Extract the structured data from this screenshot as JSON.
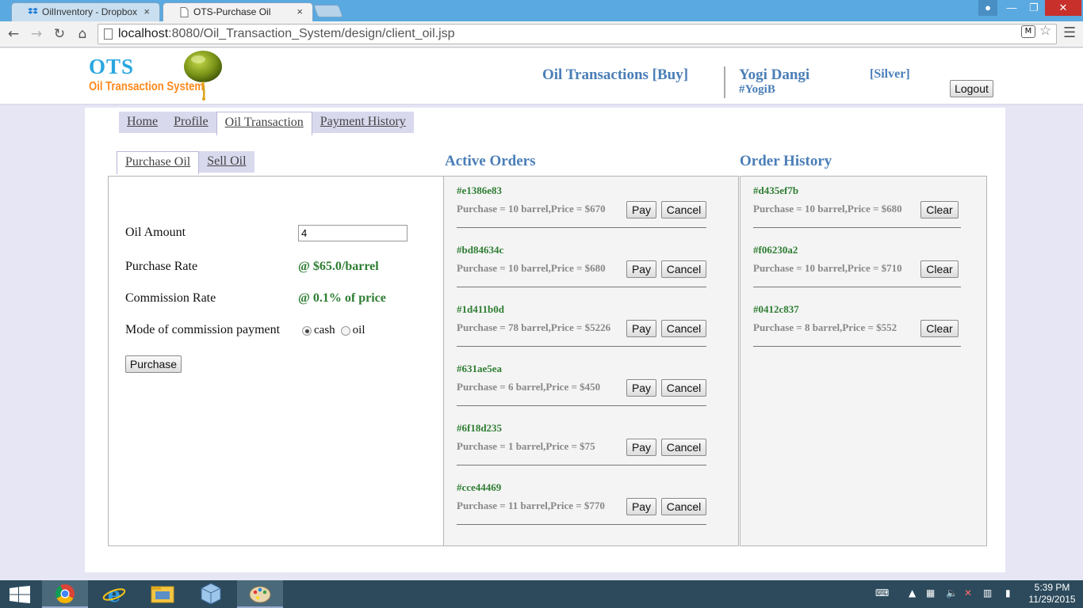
{
  "browser": {
    "tabs": [
      {
        "title": "OilInventory - Dropbox"
      },
      {
        "title": "OTS-Purchase Oil"
      }
    ],
    "url_host": "localhost",
    "url_rest": ":8080/Oil_Transaction_System/design/client_oil.jsp"
  },
  "header": {
    "logo_title": "OTS",
    "logo_subtitle": "Oil Transaction System",
    "page_title": "Oil Transactions [Buy]",
    "user_name": "Yogi Dangi",
    "user_handle": "#YogiB",
    "tier": "[Silver]",
    "logout_label": "Logout"
  },
  "nav": {
    "items": [
      {
        "label": "Home"
      },
      {
        "label": "Profile"
      },
      {
        "label": "Oil Transaction"
      },
      {
        "label": "Payment History"
      }
    ],
    "active": "Oil Transaction"
  },
  "subnav": {
    "items": [
      {
        "label": "Purchase Oil"
      },
      {
        "label": "Sell Oil"
      }
    ],
    "active": "Purchase Oil"
  },
  "form": {
    "amount_label": "Oil Amount",
    "amount_value": "4",
    "rate_label": "Purchase Rate",
    "rate_value": "@ $65.0/barrel",
    "commission_label": "Commission Rate",
    "commission_value": "@ 0.1% of price",
    "mode_label": "Mode of commission payment",
    "mode_options": [
      "cash",
      "oil"
    ],
    "mode_selected": "cash",
    "purchase_label": "Purchase"
  },
  "active_orders": {
    "title": "Active Orders",
    "pay_label": "Pay",
    "cancel_label": "Cancel",
    "orders": [
      {
        "id": "#e1386e83",
        "desc": "Purchase = 10 barrel,Price = $670"
      },
      {
        "id": "#bd84634c",
        "desc": "Purchase = 10 barrel,Price = $680"
      },
      {
        "id": "#1d411b0d",
        "desc": "Purchase = 78 barrel,Price = $5226"
      },
      {
        "id": "#631ae5ea",
        "desc": "Purchase = 6 barrel,Price = $450"
      },
      {
        "id": "#6f18d235",
        "desc": "Purchase = 1 barrel,Price = $75"
      },
      {
        "id": "#cce44469",
        "desc": "Purchase = 11 barrel,Price = $770"
      }
    ]
  },
  "order_history": {
    "title": "Order History",
    "clear_label": "Clear",
    "orders": [
      {
        "id": "#d435ef7b",
        "desc": "Purchase = 10 barrel,Price = $680"
      },
      {
        "id": "#f06230a2",
        "desc": "Purchase = 10 barrel,Price = $710"
      },
      {
        "id": "#0412c837",
        "desc": "Purchase = 8 barrel,Price = $552"
      }
    ]
  },
  "taskbar": {
    "time": "5:39 PM",
    "date": "11/29/2015",
    "apps": [
      "chrome-icon",
      "internet-explorer-icon",
      "file-explorer-icon",
      "virtualbox-icon",
      "paint-icon"
    ]
  },
  "colors": {
    "accent_blue": "#4a7eb7",
    "order_id_green": "#2e7d32",
    "logo_blue": "#2aa7e0",
    "logo_orange": "#ff8a1e",
    "page_background": "#e6e6f5"
  }
}
